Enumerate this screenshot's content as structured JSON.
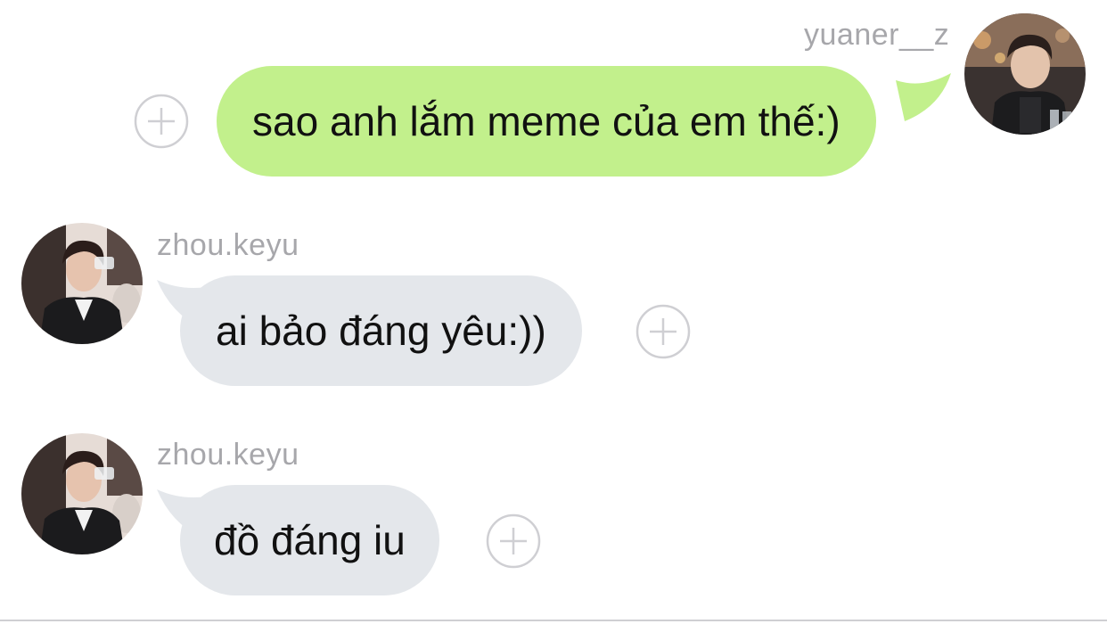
{
  "colors": {
    "outgoing_bubble": "#c2f08c",
    "incoming_bubble": "#e4e7eb",
    "username_text": "#a7a7ab",
    "plus_icon": "#cfcfd3"
  },
  "messages": [
    {
      "sender": "yuaner__z",
      "direction": "outgoing",
      "text": "sao anh lắm meme của em thế:)",
      "action_icon": "plus-circle-icon"
    },
    {
      "sender": "zhou.keyu",
      "direction": "incoming",
      "text": "ai bảo đáng yêu:))",
      "action_icon": "plus-circle-icon"
    },
    {
      "sender": "zhou.keyu",
      "direction": "incoming",
      "text": "đồ đáng iu",
      "action_icon": "plus-circle-icon"
    }
  ]
}
